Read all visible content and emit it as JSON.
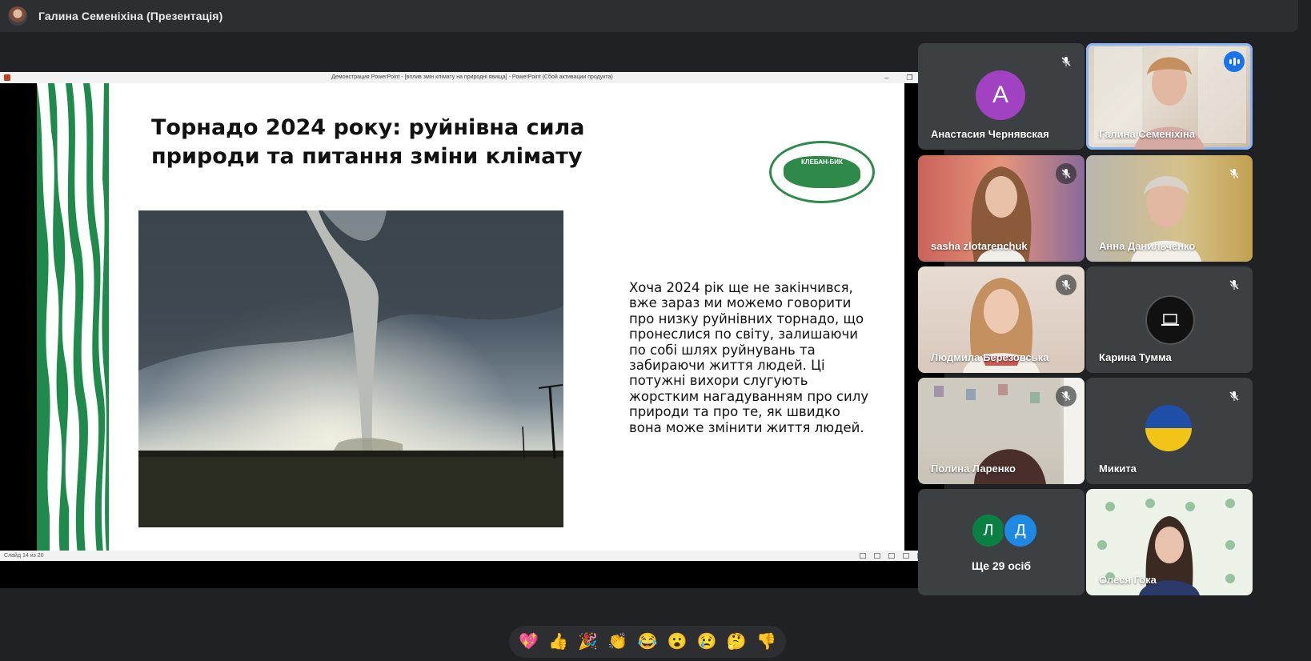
{
  "header": {
    "title": "Галина Семеніхіна (Презентація)"
  },
  "powerpoint": {
    "window_title": "Демонстрация PowerPoint - [вплив змін клімату на природні явища] - PowerPoint (Сбой активации продукта)",
    "controls": [
      "–",
      "❐",
      "✕"
    ],
    "status_slide": "Слайд 14 из 20"
  },
  "slide": {
    "title": "Торнадо 2024 року: руйнівна сила природи та питання зміни клімату",
    "logo_text": "КЛЕБАН-БИК",
    "body": "Хоча 2024 рік ще не закінчився, вже зараз ми можемо говорити про низку руйнівних торнадо, що пронеслися по світу, залишаючи по собі шлях руйнувань та забираючи життя людей. Ці потужні вихори слугують жорстким нагадуванням про силу природи та про те, як швидко вона може змінити життя людей."
  },
  "participants": [
    {
      "name": "Анастасия Чернявская",
      "initial": "A",
      "avatar_color": "#a142c3",
      "muted": true
    },
    {
      "name": "Галина Семеніхіна",
      "speaking": true
    },
    {
      "name": "sasha zlotarenchuk",
      "muted": true
    },
    {
      "name": "Анна Данильченко",
      "muted": true
    },
    {
      "name": "Людмила Березовська",
      "muted": true
    },
    {
      "name": "Карина Тумма",
      "muted": true
    },
    {
      "name": "Полина Ларенко",
      "muted": true
    },
    {
      "name": "Микита",
      "muted": true
    },
    {
      "name": "Олеся Гока"
    }
  ],
  "more": {
    "label": "Ще 29 осіб",
    "initials": [
      "Л",
      "Д"
    ],
    "colors": [
      "#0b8043",
      "#1e88e5"
    ]
  },
  "reactions": [
    "💖",
    "👍",
    "🎉",
    "👏",
    "😂",
    "😮",
    "😢",
    "🤔",
    "👎"
  ],
  "colors": {
    "accent": "#8ab4f8",
    "tile_bg": "#3c4043",
    "page_bg": "#202124",
    "slide_green": "#2f8a4a"
  }
}
